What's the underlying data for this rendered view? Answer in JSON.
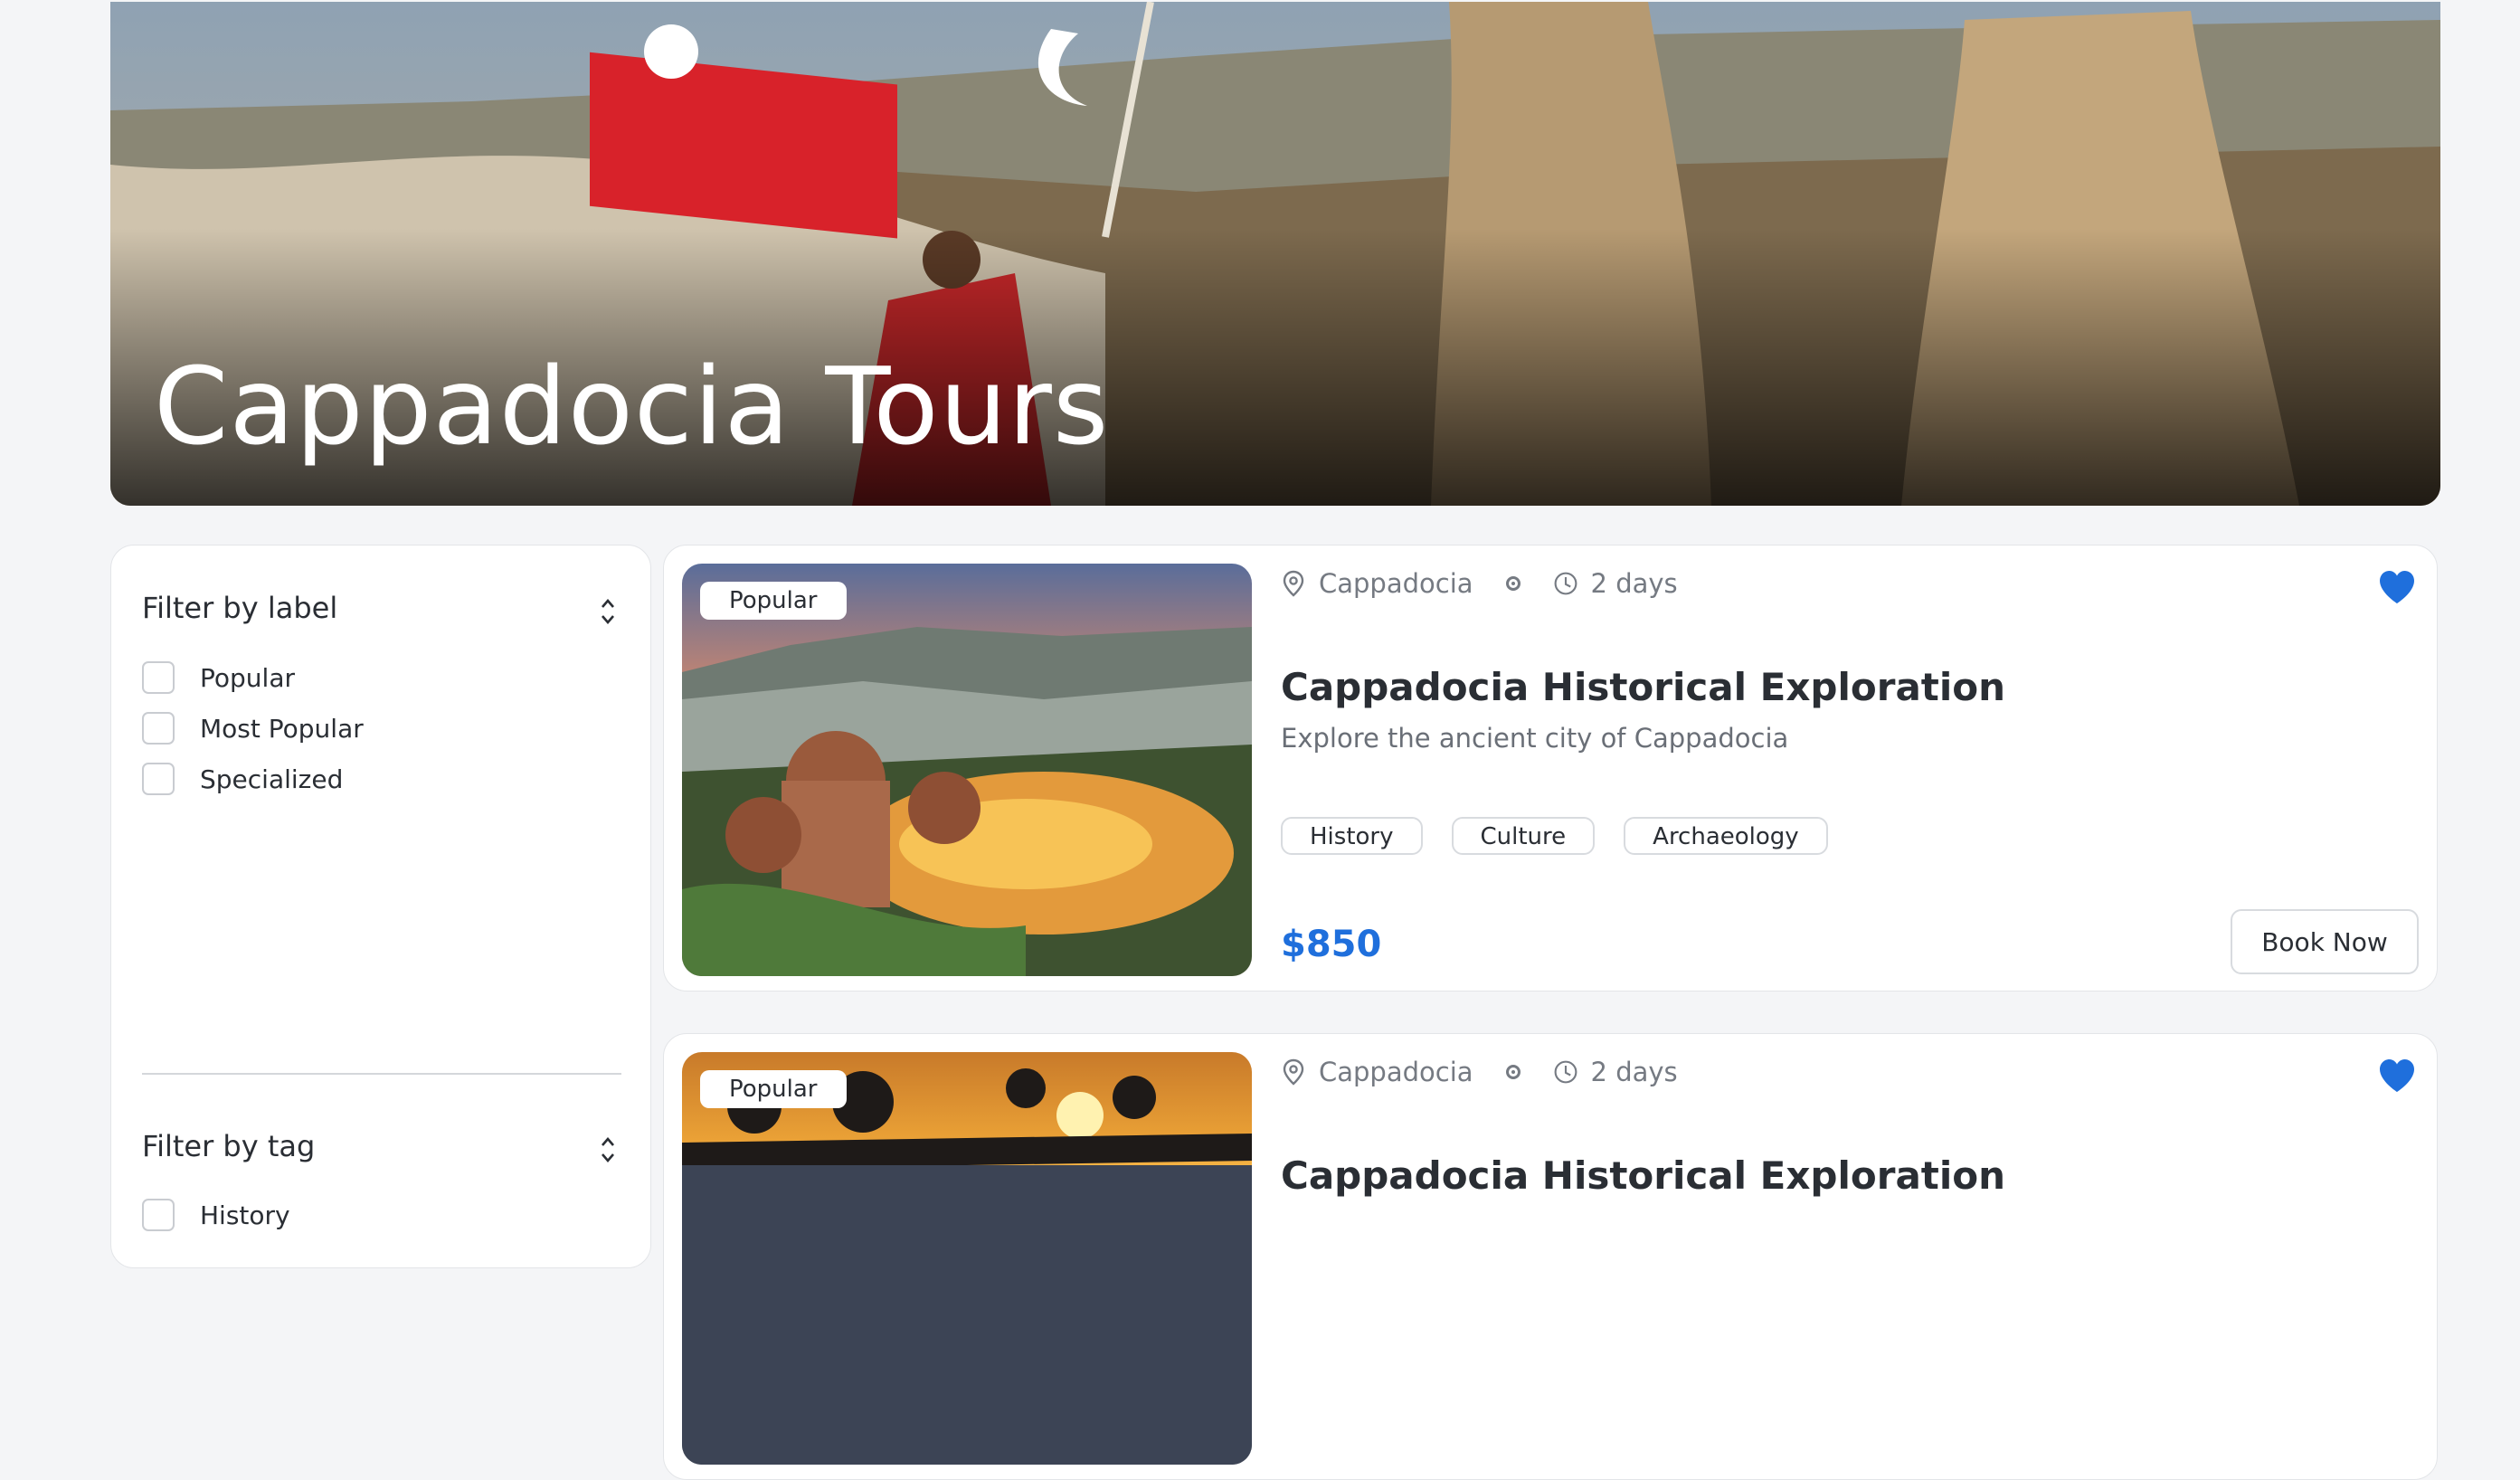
{
  "hero": {
    "title": "Cappadocia Tours"
  },
  "sidebar": {
    "filters": [
      {
        "title": "Filter by label",
        "options": [
          "Popular",
          "Most Popular",
          "Specialized"
        ]
      },
      {
        "title": "Filter by tag",
        "options": [
          "History"
        ]
      }
    ]
  },
  "tours": [
    {
      "badge": "Popular",
      "location": "Cappadocia",
      "duration": "2 days",
      "title": "Cappadocia Historical Exploration",
      "subtitle": "Explore the ancient city of Cappadocia",
      "tags": [
        "History",
        "Culture",
        "Archaeology"
      ],
      "price": "$850",
      "book_label": "Book Now",
      "favorited": true
    },
    {
      "badge": "Popular",
      "location": "Cappadocia",
      "duration": "2 days",
      "title": "Cappadocia Historical Exploration",
      "favorited": true
    }
  ],
  "colors": {
    "accent": "#1f6fdc",
    "background": "#f4f5f7"
  }
}
